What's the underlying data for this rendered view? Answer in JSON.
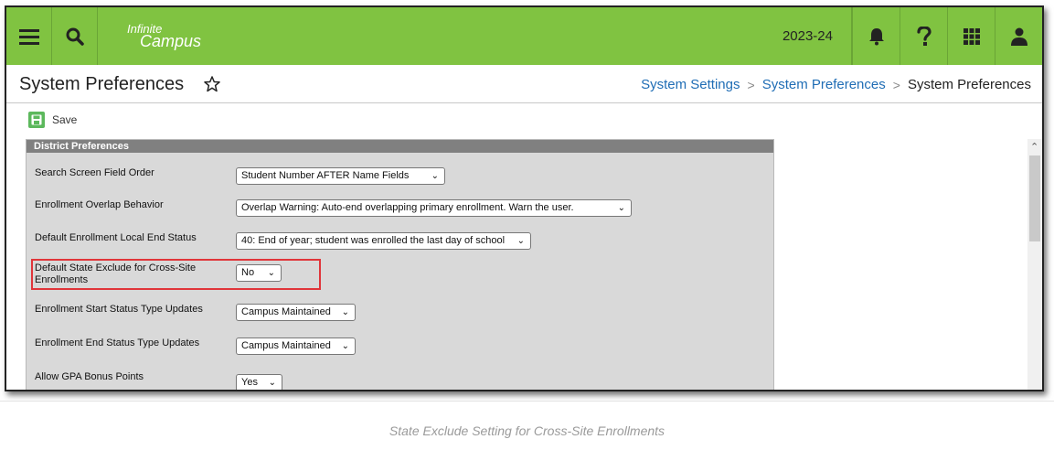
{
  "app": {
    "logo_line1": "Infinite",
    "logo_line2": "Campus",
    "school_year": "2023-24"
  },
  "header": {
    "title": "System Preferences",
    "breadcrumbs": [
      "System Settings",
      "System Preferences",
      "System Preferences"
    ]
  },
  "toolbar": {
    "save_label": "Save"
  },
  "panel": {
    "heading": "District Preferences",
    "rows": [
      {
        "label": "Search Screen Field Order",
        "value": "Student Number AFTER Name Fields"
      },
      {
        "label": "Enrollment Overlap Behavior",
        "value": "Overlap Warning: Auto-end overlapping primary enrollment. Warn the user."
      },
      {
        "label": "Default Enrollment Local End Status",
        "value": "40: End of year; student was enrolled the last day of school"
      },
      {
        "label": "Default State Exclude for Cross-Site Enrollments",
        "value": "No"
      },
      {
        "label": "Enrollment Start Status Type Updates",
        "value": "Campus Maintained"
      },
      {
        "label": "Enrollment End Status Type Updates",
        "value": "Campus Maintained"
      },
      {
        "label": "Allow GPA Bonus Points",
        "value": "Yes"
      }
    ]
  },
  "caption": "State Exclude Setting for Cross-Site Enrollments",
  "colors": {
    "topbar": "#80c341",
    "link": "#1f6db5",
    "highlight": "#e0353a",
    "panel_heading": "#808080"
  },
  "icons": [
    "menu-icon",
    "search-icon",
    "bell-icon",
    "help-icon",
    "apps-grid-icon",
    "user-icon",
    "star-icon",
    "save-icon"
  ]
}
